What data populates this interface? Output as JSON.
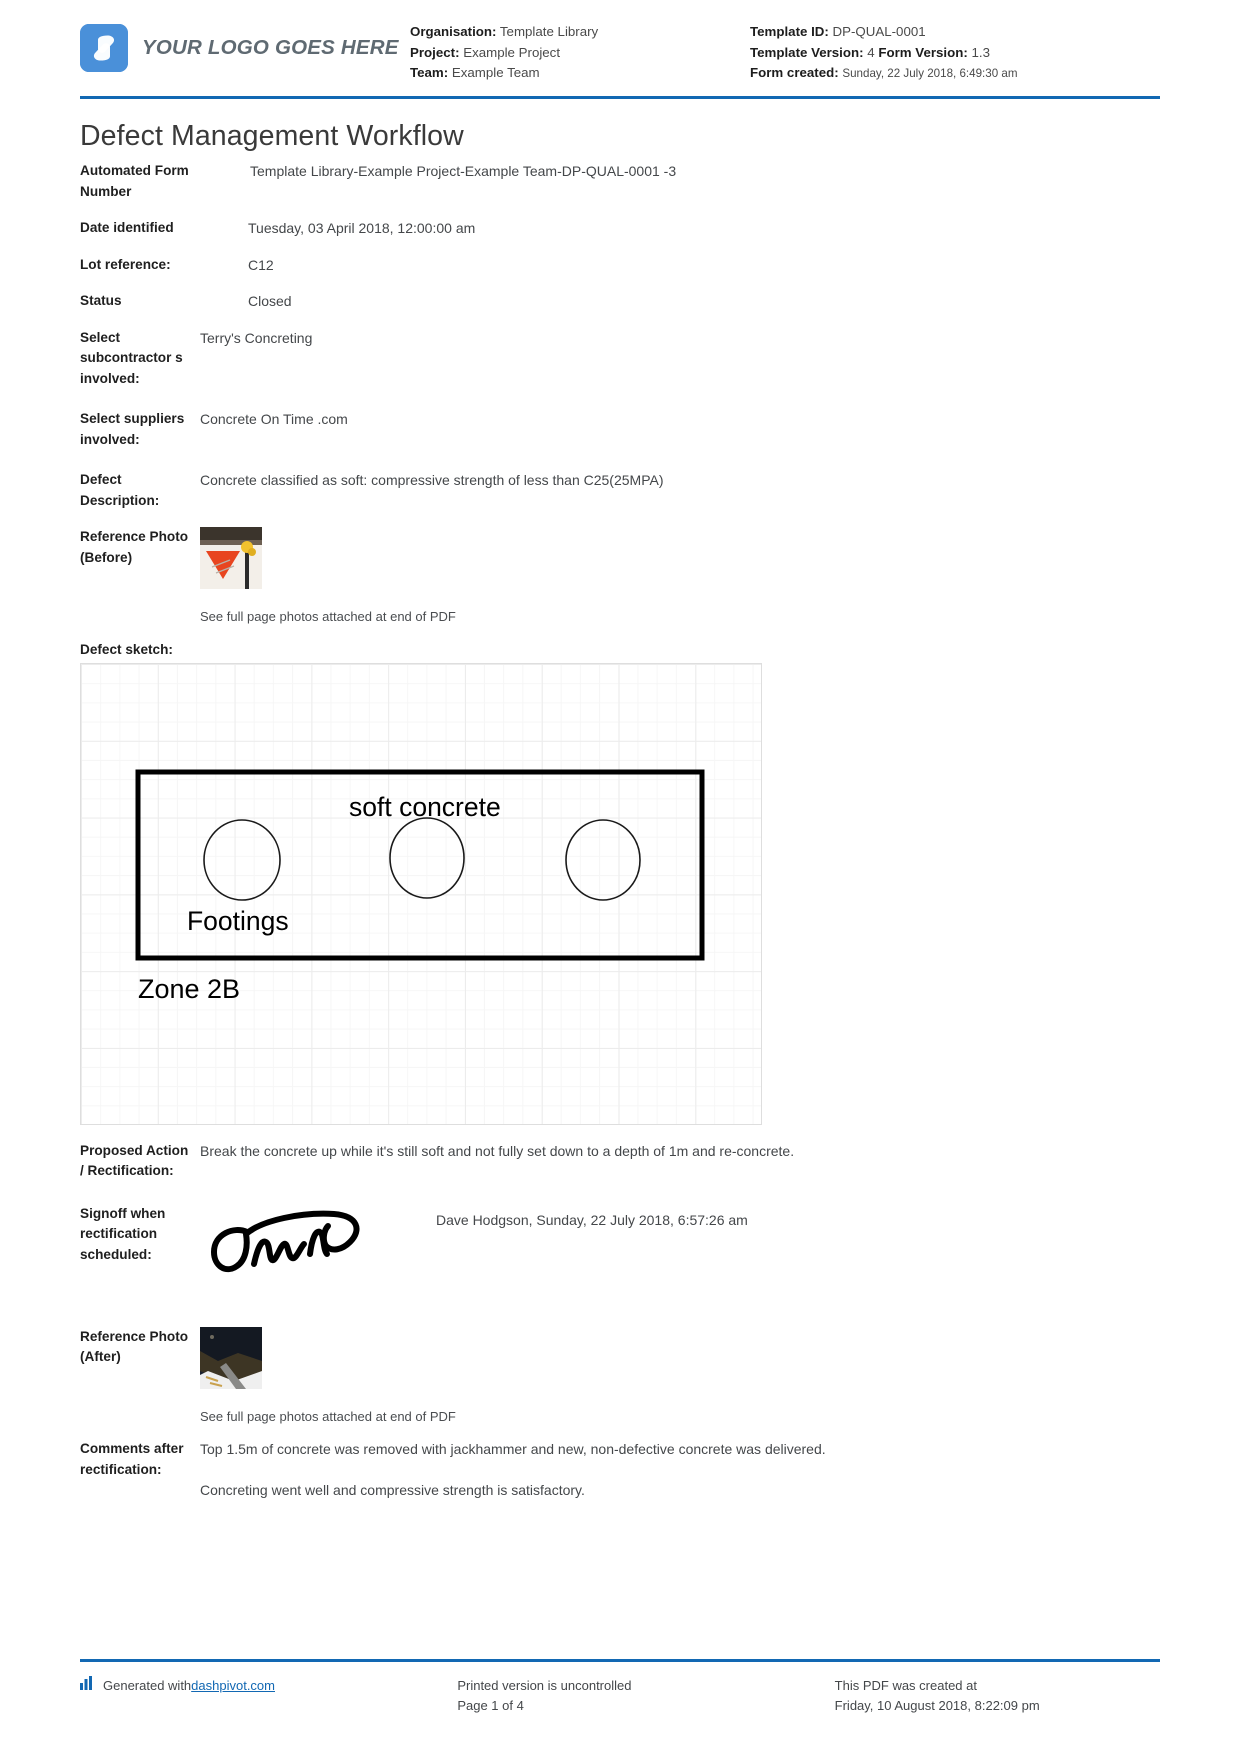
{
  "header": {
    "logo_text": "YOUR LOGO GOES HERE",
    "logo_icon": "dashpivot-logo-icon",
    "accent_color": "#1268b3",
    "logo_color": "#4a90d9",
    "organisation_label": "Organisation:",
    "organisation_value": "Template Library",
    "project_label": "Project:",
    "project_value": "Example Project",
    "team_label": "Team:",
    "team_value": "Example Team",
    "template_id_label": "Template ID:",
    "template_id_value": "DP-QUAL-0001",
    "template_version_label": "Template Version:",
    "template_version_value": "4",
    "form_version_label": "Form Version:",
    "form_version_value": "1.3",
    "form_created_label": "Form created:",
    "form_created_value": "Sunday, 22 July 2018, 6:49:30 am"
  },
  "title": "Defect Management Workflow",
  "fields": {
    "automated_form_number_label": "Automated Form Number",
    "automated_form_number_value": "Template Library-Example Project-Example Team-DP-QUAL-0001   -3",
    "date_identified_label": "Date identified",
    "date_identified_value": "Tuesday, 03 April 2018, 12:00:00 am",
    "lot_reference_label": "Lot reference:",
    "lot_reference_value": "C12",
    "status_label": "Status",
    "status_value": "Closed",
    "subcontractors_label": "Select subcontractor s involved:",
    "subcontractors_value": "Terry's Concreting",
    "suppliers_label": "Select suppliers involved:",
    "suppliers_value": "Concrete On Time .com",
    "defect_description_label": "Defect Description:",
    "defect_description_value": "Concrete classified as soft: compressive strength of less than C25(25MPA)",
    "reference_photo_before_label": "Reference Photo (Before)",
    "reference_photo_before_caption": "See full page photos attached at end of PDF",
    "defect_sketch_label": "Defect sketch:",
    "proposed_action_label": "Proposed Action / Rectification:",
    "proposed_action_value": "Break the concrete up while it's still soft and not fully set down to a depth of 1m and re-concrete.",
    "signoff_label": "Signoff when rectification scheduled:",
    "signoff_value": "Dave Hodgson, Sunday, 22 July 2018, 6:57:26 am",
    "reference_photo_after_label": "Reference Photo (After)",
    "reference_photo_after_caption": "See full page photos attached at end of PDF",
    "comments_label": "Comments after rectification:",
    "comments_value_1": "Top 1.5m of concrete was removed with jackhammer and new, non-defective concrete was delivered.",
    "comments_value_2": "Concreting went well and compressive strength is satisfactory."
  },
  "sketch": {
    "annotation_top": "soft concrete",
    "annotation_footings": "Footings",
    "annotation_zone": "Zone 2B",
    "footing_count": 3
  },
  "footer": {
    "generated_prefix": "Generated with ",
    "generated_link": "dashpivot.com",
    "printed_line_1": "Printed version is uncontrolled",
    "printed_line_2": "Page 1 of 4",
    "created_line_1": "This PDF was created at",
    "created_line_2": "Friday, 10 August 2018, 8:22:09 pm"
  }
}
